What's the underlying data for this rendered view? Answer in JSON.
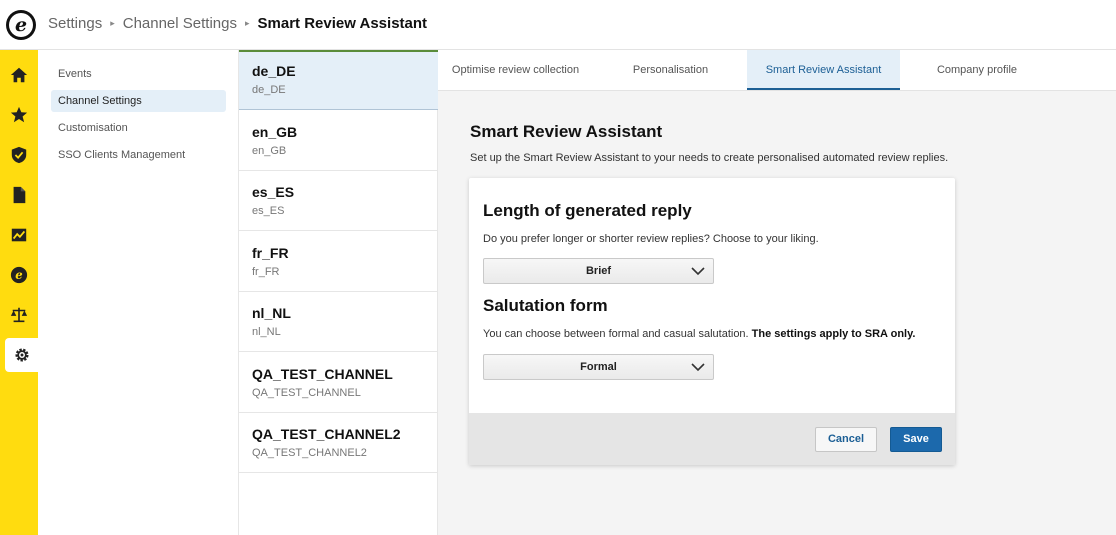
{
  "header": {
    "logo_letter": "e",
    "breadcrumb": [
      "Settings",
      "Channel Settings",
      "Smart Review Assistant"
    ]
  },
  "rail": {
    "items": [
      {
        "icon": "home-icon"
      },
      {
        "icon": "star-icon"
      },
      {
        "icon": "shield-check-icon"
      },
      {
        "icon": "document-icon"
      },
      {
        "icon": "chart-icon"
      },
      {
        "icon": "brand-e-icon"
      },
      {
        "icon": "scale-icon"
      },
      {
        "icon": "gear-icon",
        "active": true
      }
    ],
    "color": "#ffdc0f"
  },
  "submenu": {
    "items": [
      "Events",
      "Channel Settings",
      "Customisation",
      "SSO Clients Management"
    ],
    "active_index": 1
  },
  "channels": [
    {
      "name": "de_DE",
      "sub": "de_DE",
      "active": true
    },
    {
      "name": "en_GB",
      "sub": "en_GB"
    },
    {
      "name": "es_ES",
      "sub": "es_ES"
    },
    {
      "name": "fr_FR",
      "sub": "fr_FR"
    },
    {
      "name": "nl_NL",
      "sub": "nl_NL"
    },
    {
      "name": "QA_TEST_CHANNEL",
      "sub": "QA_TEST_CHANNEL"
    },
    {
      "name": "QA_TEST_CHANNEL2",
      "sub": "QA_TEST_CHANNEL2"
    }
  ],
  "tabs": [
    "Optimise review collection",
    "Personalisation",
    "Smart Review Assistant",
    "Company profile"
  ],
  "active_tab": 2,
  "main": {
    "title": "Smart Review Assistant",
    "description": "Set up the Smart Review Assistant to your needs to create personalised automated review replies.",
    "length_section": {
      "title": "Length of generated reply",
      "description": "Do you prefer longer or shorter review replies? Choose to your liking.",
      "selected": "Brief"
    },
    "salutation_section": {
      "title": "Salutation form",
      "description": "You can choose between formal and casual salutation.",
      "description_bold": "The settings apply to SRA only.",
      "selected": "Formal"
    },
    "cancel_label": "Cancel",
    "save_label": "Save"
  },
  "colors": {
    "accent": "#1c69ac",
    "active_bg": "#e4eff8"
  }
}
